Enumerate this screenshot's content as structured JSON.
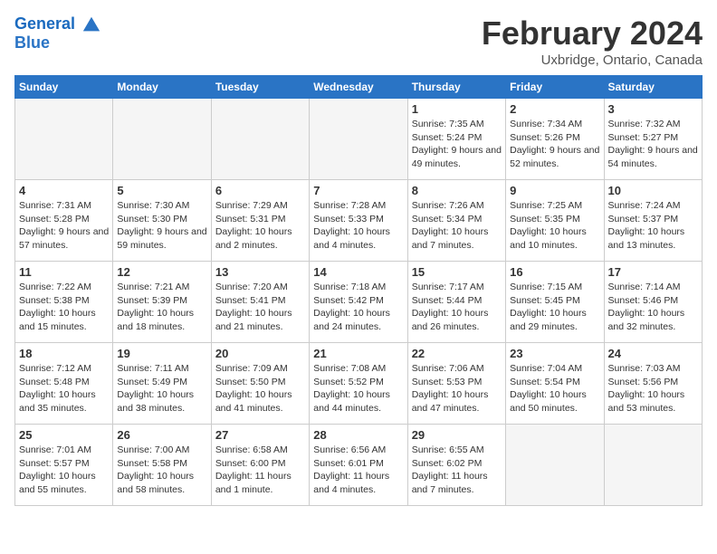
{
  "logo": {
    "line1": "General",
    "line2": "Blue"
  },
  "title": "February 2024",
  "subtitle": "Uxbridge, Ontario, Canada",
  "weekdays": [
    "Sunday",
    "Monday",
    "Tuesday",
    "Wednesday",
    "Thursday",
    "Friday",
    "Saturday"
  ],
  "weeks": [
    [
      {
        "day": "",
        "info": ""
      },
      {
        "day": "",
        "info": ""
      },
      {
        "day": "",
        "info": ""
      },
      {
        "day": "",
        "info": ""
      },
      {
        "day": "1",
        "info": "Sunrise: 7:35 AM\nSunset: 5:24 PM\nDaylight: 9 hours and 49 minutes."
      },
      {
        "day": "2",
        "info": "Sunrise: 7:34 AM\nSunset: 5:26 PM\nDaylight: 9 hours and 52 minutes."
      },
      {
        "day": "3",
        "info": "Sunrise: 7:32 AM\nSunset: 5:27 PM\nDaylight: 9 hours and 54 minutes."
      }
    ],
    [
      {
        "day": "4",
        "info": "Sunrise: 7:31 AM\nSunset: 5:28 PM\nDaylight: 9 hours and 57 minutes."
      },
      {
        "day": "5",
        "info": "Sunrise: 7:30 AM\nSunset: 5:30 PM\nDaylight: 9 hours and 59 minutes."
      },
      {
        "day": "6",
        "info": "Sunrise: 7:29 AM\nSunset: 5:31 PM\nDaylight: 10 hours and 2 minutes."
      },
      {
        "day": "7",
        "info": "Sunrise: 7:28 AM\nSunset: 5:33 PM\nDaylight: 10 hours and 4 minutes."
      },
      {
        "day": "8",
        "info": "Sunrise: 7:26 AM\nSunset: 5:34 PM\nDaylight: 10 hours and 7 minutes."
      },
      {
        "day": "9",
        "info": "Sunrise: 7:25 AM\nSunset: 5:35 PM\nDaylight: 10 hours and 10 minutes."
      },
      {
        "day": "10",
        "info": "Sunrise: 7:24 AM\nSunset: 5:37 PM\nDaylight: 10 hours and 13 minutes."
      }
    ],
    [
      {
        "day": "11",
        "info": "Sunrise: 7:22 AM\nSunset: 5:38 PM\nDaylight: 10 hours and 15 minutes."
      },
      {
        "day": "12",
        "info": "Sunrise: 7:21 AM\nSunset: 5:39 PM\nDaylight: 10 hours and 18 minutes."
      },
      {
        "day": "13",
        "info": "Sunrise: 7:20 AM\nSunset: 5:41 PM\nDaylight: 10 hours and 21 minutes."
      },
      {
        "day": "14",
        "info": "Sunrise: 7:18 AM\nSunset: 5:42 PM\nDaylight: 10 hours and 24 minutes."
      },
      {
        "day": "15",
        "info": "Sunrise: 7:17 AM\nSunset: 5:44 PM\nDaylight: 10 hours and 26 minutes."
      },
      {
        "day": "16",
        "info": "Sunrise: 7:15 AM\nSunset: 5:45 PM\nDaylight: 10 hours and 29 minutes."
      },
      {
        "day": "17",
        "info": "Sunrise: 7:14 AM\nSunset: 5:46 PM\nDaylight: 10 hours and 32 minutes."
      }
    ],
    [
      {
        "day": "18",
        "info": "Sunrise: 7:12 AM\nSunset: 5:48 PM\nDaylight: 10 hours and 35 minutes."
      },
      {
        "day": "19",
        "info": "Sunrise: 7:11 AM\nSunset: 5:49 PM\nDaylight: 10 hours and 38 minutes."
      },
      {
        "day": "20",
        "info": "Sunrise: 7:09 AM\nSunset: 5:50 PM\nDaylight: 10 hours and 41 minutes."
      },
      {
        "day": "21",
        "info": "Sunrise: 7:08 AM\nSunset: 5:52 PM\nDaylight: 10 hours and 44 minutes."
      },
      {
        "day": "22",
        "info": "Sunrise: 7:06 AM\nSunset: 5:53 PM\nDaylight: 10 hours and 47 minutes."
      },
      {
        "day": "23",
        "info": "Sunrise: 7:04 AM\nSunset: 5:54 PM\nDaylight: 10 hours and 50 minutes."
      },
      {
        "day": "24",
        "info": "Sunrise: 7:03 AM\nSunset: 5:56 PM\nDaylight: 10 hours and 53 minutes."
      }
    ],
    [
      {
        "day": "25",
        "info": "Sunrise: 7:01 AM\nSunset: 5:57 PM\nDaylight: 10 hours and 55 minutes."
      },
      {
        "day": "26",
        "info": "Sunrise: 7:00 AM\nSunset: 5:58 PM\nDaylight: 10 hours and 58 minutes."
      },
      {
        "day": "27",
        "info": "Sunrise: 6:58 AM\nSunset: 6:00 PM\nDaylight: 11 hours and 1 minute."
      },
      {
        "day": "28",
        "info": "Sunrise: 6:56 AM\nSunset: 6:01 PM\nDaylight: 11 hours and 4 minutes."
      },
      {
        "day": "29",
        "info": "Sunrise: 6:55 AM\nSunset: 6:02 PM\nDaylight: 11 hours and 7 minutes."
      },
      {
        "day": "",
        "info": ""
      },
      {
        "day": "",
        "info": ""
      }
    ]
  ]
}
